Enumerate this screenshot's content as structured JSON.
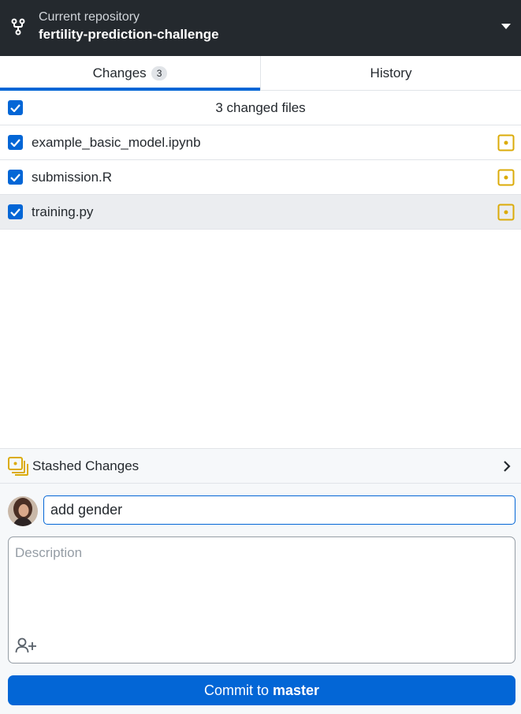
{
  "header": {
    "label": "Current repository",
    "repo_name": "fertility-prediction-challenge",
    "icon": "repo-fork-icon"
  },
  "tabs": [
    {
      "label": "Changes",
      "count": "3",
      "active": true
    },
    {
      "label": "History",
      "active": false
    }
  ],
  "changes": {
    "summary": "3 changed files",
    "files": [
      {
        "name": "example_basic_model.ipynb",
        "checked": true,
        "status": "modified"
      },
      {
        "name": "submission.R",
        "checked": true,
        "status": "modified"
      },
      {
        "name": "training.py",
        "checked": true,
        "status": "modified",
        "selected": true
      }
    ]
  },
  "stash": {
    "label": "Stashed Changes"
  },
  "commit": {
    "summary_value": "add gender",
    "description_placeholder": "Description",
    "button_prefix": "Commit to",
    "branch": "master"
  },
  "colors": {
    "header_bg": "#24292e",
    "accent": "#0366d6",
    "modified": "#dbab09"
  }
}
